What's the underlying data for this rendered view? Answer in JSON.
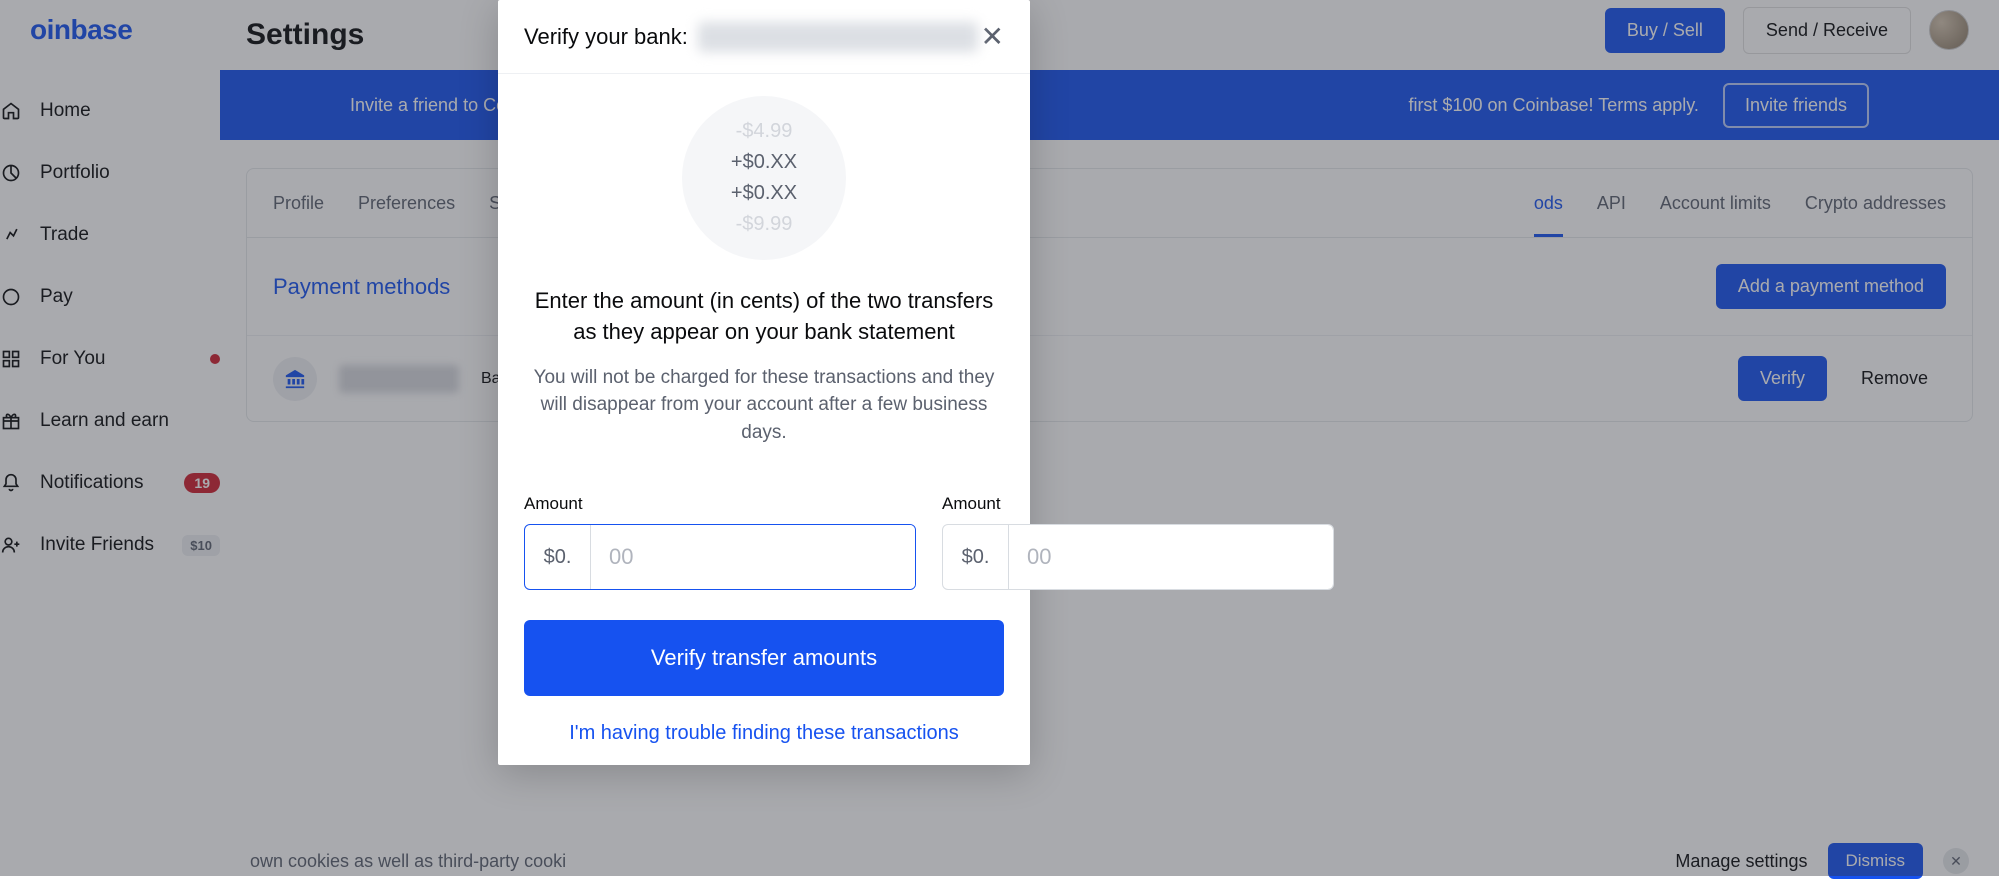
{
  "brand": "oinbase",
  "header": {
    "buy_sell": "Buy / Sell",
    "send_receive": "Send / Receive"
  },
  "page_title": "Settings",
  "banner": {
    "text_left": "Invite a friend to Coin",
    "text_right": "first $100 on Coinbase! Terms apply.",
    "button": "Invite friends"
  },
  "sidebar": {
    "items": [
      {
        "label": "Home"
      },
      {
        "label": "Portfolio"
      },
      {
        "label": "Trade"
      },
      {
        "label": "Pay"
      },
      {
        "label": "For You"
      },
      {
        "label": "Learn and earn"
      },
      {
        "label": "Notifications",
        "badge": "19"
      },
      {
        "label": "Invite Friends",
        "badge": "$10"
      }
    ]
  },
  "tabs": {
    "profile": "Profile",
    "preferences": "Preferences",
    "security_partial": "Se",
    "payment_partial": "ods",
    "api": "API",
    "account_limits": "Account limits",
    "crypto_addresses": "Crypto addresses"
  },
  "payment": {
    "section_title": "Payment methods",
    "add_button": "Add a payment method",
    "row_label_partial": "Bar",
    "verify": "Verify",
    "remove": "Remove"
  },
  "cookie": {
    "text": "own cookies as well as third-party cooki",
    "manage": "Manage settings",
    "dismiss": "Dismiss"
  },
  "modal": {
    "title_prefix": "Verify your bank:",
    "demo_lines": [
      "-$4.99",
      "+$0.XX",
      "+$0.XX",
      "-$9.99"
    ],
    "instruction1": "Enter the amount (in cents) of the two transfers as they appear on your bank statement",
    "instruction2": "You will not be charged for these transactions and they will disappear from your account after a few business days.",
    "amount_label": "Amount",
    "prefix": "$0.",
    "placeholder": "00",
    "verify_button": "Verify transfer amounts",
    "trouble_link": "I'm having trouble finding these transactions"
  }
}
